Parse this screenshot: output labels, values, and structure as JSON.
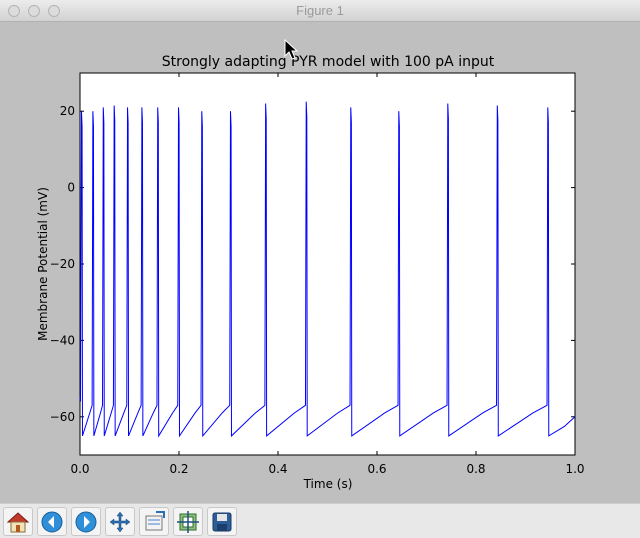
{
  "window": {
    "title": "Figure 1"
  },
  "chart_data": {
    "type": "line",
    "title": "Strongly adapting PYR model with 100 pA input",
    "xlabel": "Time (s)",
    "ylabel": "Membrane Potential (mV)",
    "xlim": [
      0.0,
      1.0
    ],
    "ylim": [
      -70,
      30
    ],
    "xticks": [
      0.0,
      0.2,
      0.4,
      0.6,
      0.8,
      1.0
    ],
    "xtick_labels": [
      "0.0",
      "0.2",
      "0.4",
      "0.6",
      "0.8",
      "1.0"
    ],
    "yticks": [
      -60,
      -40,
      -20,
      0,
      20
    ],
    "ytick_labels": [
      "−60",
      "−40",
      "−20",
      "0",
      "20"
    ],
    "grid": false,
    "series": [
      {
        "color": "#0000ff",
        "spike_times": [
          0.003,
          0.026,
          0.047,
          0.069,
          0.096,
          0.125,
          0.157,
          0.199,
          0.246,
          0.304,
          0.375,
          0.457,
          0.547,
          0.644,
          0.743,
          0.843,
          0.945
        ],
        "spike_peaks": [
          20,
          20,
          21,
          21.5,
          21,
          21,
          21,
          21,
          20,
          20,
          22,
          22.5,
          21,
          20,
          22,
          21.5,
          21
        ],
        "reset": -65,
        "pre_spike": -57,
        "end_value": -60
      }
    ]
  },
  "toolbar": {
    "buttons": [
      {
        "icon": "home-icon"
      },
      {
        "icon": "back-icon"
      },
      {
        "icon": "forward-icon"
      },
      {
        "icon": "pan-icon"
      },
      {
        "icon": "zoom-icon"
      },
      {
        "icon": "subplots-icon"
      },
      {
        "icon": "save-icon"
      }
    ]
  }
}
